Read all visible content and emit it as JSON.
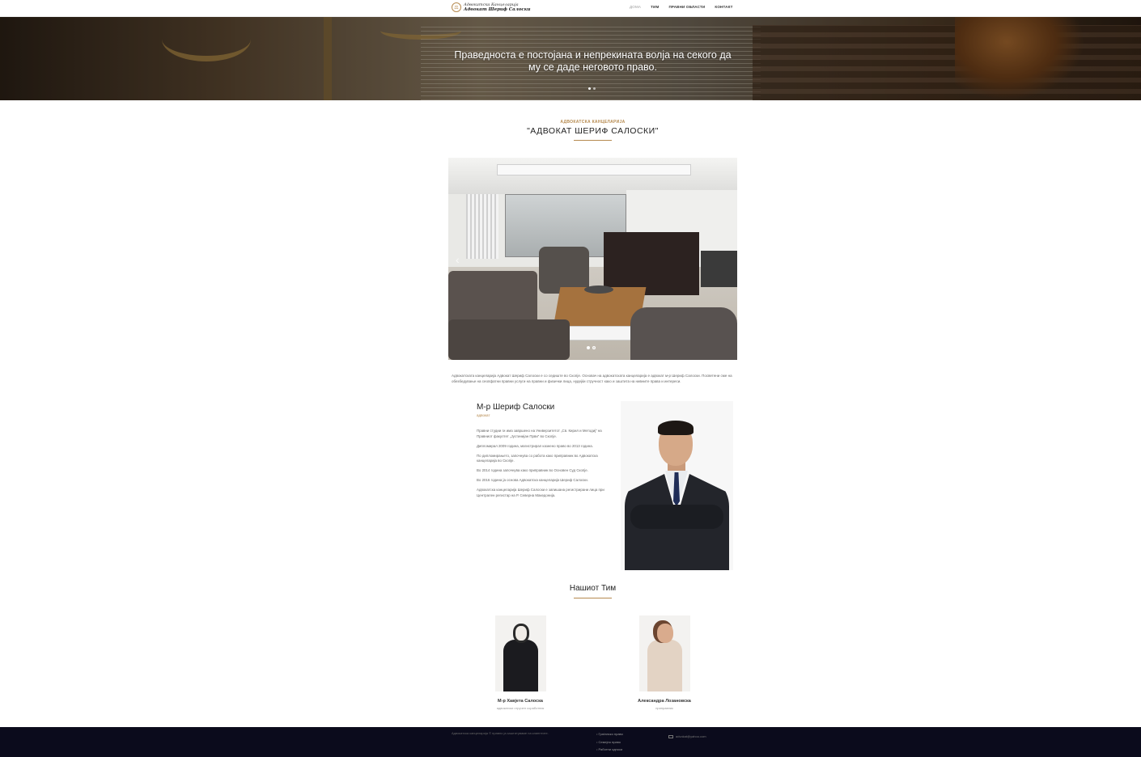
{
  "header": {
    "logo_line1": "Адвокатска Канцеларија",
    "logo_line2": "Адвокат Шериф Салоски",
    "nav": [
      "ДОМА",
      "ТИМ",
      "ПРАВНИ ОБЛАСТИ",
      "КОНТАКТ"
    ]
  },
  "hero": {
    "quote": "Праведноста е постојана и непрекината волја на секого да му се даде неговото право."
  },
  "firm": {
    "eyebrow": "АДВОКАТСКА КАНЦЕЛАРИЈА",
    "title": "\"АДВОКАТ ШЕРИФ САЛОСКИ\""
  },
  "about": "Адвокатската канцеларија Адвокат Шериф Салоски е со седиште во Скопје. Основач на адвокатската канцеларија е адвокат м-р Шериф Салоски. Посветени сме на обезбедување на сеопфатни правни услуги на правни и физички лица, нудејќи стручност како и заштита на нивните права и интереси.",
  "lawyer": {
    "name": "М-р Шериф Салоски",
    "role": "адвокат",
    "bio": [
      "Правни студии ги има завршено на Универзитетот „Св. Кирил и Методиј“ на Правниот факултет „Јустинијан Први“ во Скопје.",
      "Дипломирал 2009 година, магистрирал казнено право во 2013 година.",
      "По дипломирањето, започнува со работа како приправник во Адвокатска канцеларија во Скопје.",
      "Во 2014 година започнува како приправник во Основен Суд Скопје.",
      "Во 2016 година ја основа Адвокатска канцеларија Шериф Салоски.",
      "Адвокатска канцеларија Шериф Салоски е запишана регистрирани лица при Централен регистар на Р. Северна Македонија."
    ]
  },
  "team": {
    "title": "Нашиот Тим",
    "members": [
      {
        "name": "М-р Хавјета Салоска",
        "role": "адвокатски стручен соработник"
      },
      {
        "name": "Александра Лозановска",
        "role": "приправник"
      }
    ]
  },
  "footer": {
    "copyright": "Адвокатска канцеларија © правно ја заштитуваме на клиентите.",
    "links": [
      "Граѓанско право",
      "Семејно право",
      "Работни односи"
    ],
    "email": "advokat@yahoo.com"
  },
  "colors": {
    "accent": "#b68a4f",
    "footer_bg": "#0b0b1c"
  },
  "icons": [
    "scales-logo-icon",
    "chevron-left-icon",
    "envelope-icon"
  ]
}
